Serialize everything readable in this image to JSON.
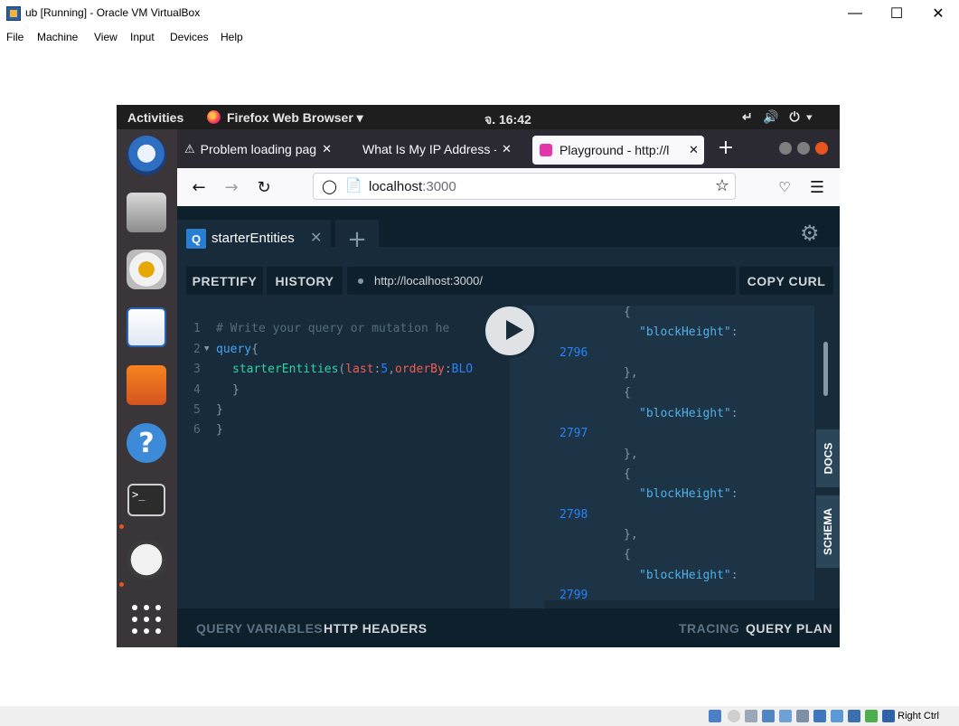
{
  "host": {
    "title": "ub [Running] - Oracle VM VirtualBox",
    "menu": [
      "File",
      "Machine",
      "View",
      "Input",
      "Devices",
      "Help"
    ],
    "host_key": "Right Ctrl"
  },
  "gnome": {
    "activities": "Activities",
    "app_name": "Firefox Web Browser",
    "clock": "จ. 16:42"
  },
  "dock": [
    "thunderbird-icon",
    "files-icon",
    "rhythmbox-icon",
    "writer-icon",
    "software-icon",
    "help-icon",
    "terminal-icon",
    "updater-icon",
    "show-apps-icon"
  ],
  "browser": {
    "tabs": [
      {
        "label": "Problem loading pag",
        "icon": "warning-icon"
      },
      {
        "label": "What Is My IP Address -  ",
        "icon": ""
      },
      {
        "label": "Playground - http://l",
        "icon": "graphql-icon"
      }
    ],
    "url_host": "localhost",
    "url_port": ":3000"
  },
  "playground": {
    "tab_badge": "Q",
    "tab_name": "starterEntities",
    "prettify": "PRETTIFY",
    "history": "HISTORY",
    "endpoint": "http://localhost:3000/",
    "copy_curl": "COPY CURL",
    "line_numbers": [
      "1",
      "2",
      "3",
      "4",
      "5",
      "6"
    ],
    "code": {
      "l1": "# Write your query or mutation he",
      "l2_kw": "query",
      "l2_brace": "{",
      "l3_field": "starterEntities",
      "l3_p1": "(",
      "l3_arg1": "last",
      "l3_colon1": ":",
      "l3_val1": "5",
      "l3_comma": ",",
      "l3_arg2": "orderBy",
      "l3_colon2": ":",
      "l3_enum": "BLO",
      "l4": "}",
      "l5": "}",
      "l6": "}"
    },
    "result": {
      "open_brace": "{",
      "key": "\"blockHeight\"",
      "colon": ":",
      "close": "},",
      "values": [
        "2796",
        "2797",
        "2798",
        "2799"
      ]
    },
    "docs": "DOCS",
    "schema": "SCHEMA",
    "query_variables": "QUERY VARIABLES",
    "http_headers": "HTTP HEADERS",
    "tracing": "TRACING",
    "query_plan": "QUERY PLAN"
  }
}
